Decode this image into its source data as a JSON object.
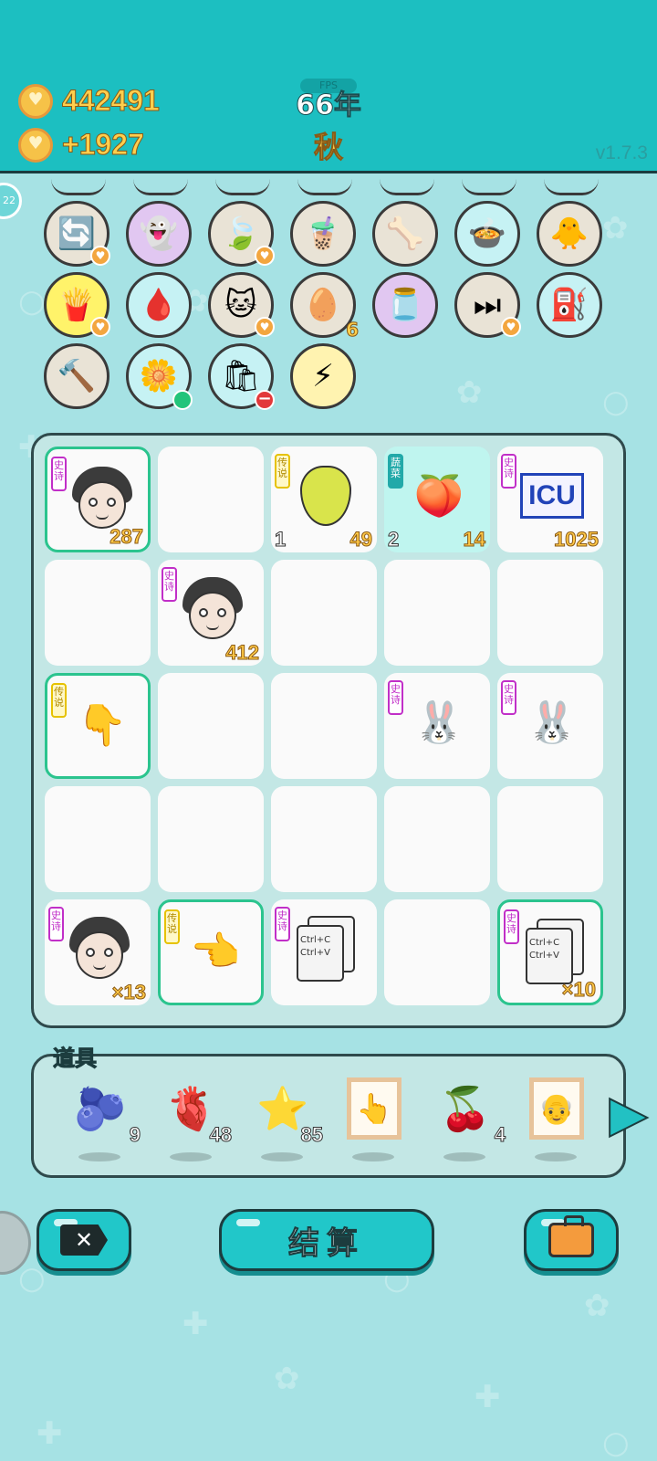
{
  "header": {
    "coins": "442491",
    "income": "+1927",
    "year_badge": "FPS",
    "year": "66年",
    "season": "秋",
    "version": "v1.7.3"
  },
  "side_badge": "22",
  "items_row1": [
    {
      "name": "refresh",
      "icon": "🔄",
      "mark": "♥"
    },
    {
      "name": "ghost",
      "icon": "👻",
      "mark": ""
    },
    {
      "name": "leaf",
      "icon": "🍃",
      "mark": "♥"
    },
    {
      "name": "bubble-tea",
      "icon": "🧋",
      "mark": ""
    },
    {
      "name": "dog-bowl",
      "icon": "🦴",
      "mark": ""
    },
    {
      "name": "pot-duck",
      "icon": "🍲",
      "mark": ""
    },
    {
      "name": "chick-egg",
      "icon": "🐥",
      "mark": ""
    }
  ],
  "items_row2": [
    {
      "name": "fries",
      "icon": "🍟",
      "mark": "♥"
    },
    {
      "name": "blood-bag",
      "icon": "🩸",
      "mark": ""
    },
    {
      "name": "cat",
      "icon": "🐱",
      "mark": "♥"
    },
    {
      "name": "egg-tray",
      "icon": "🥚",
      "count": "6"
    },
    {
      "name": "cream-jar",
      "icon": "🫙",
      "mark": ""
    },
    {
      "name": "skip",
      "icon": "⏭",
      "mark": "♥"
    },
    {
      "name": "pump",
      "icon": "⛽",
      "mark": ""
    }
  ],
  "items_row3": [
    {
      "name": "hammer",
      "icon": "🔨"
    },
    {
      "name": "flower-pot",
      "icon": "🌼"
    },
    {
      "name": "seed-bag",
      "icon": "🛍"
    },
    {
      "name": "lightning",
      "icon": "⚡"
    }
  ],
  "board": {
    "tags": {
      "epic": "史诗",
      "legend": "传说",
      "veg": "蔬菜"
    },
    "r1c1_num": "287",
    "r1c3_left": "1",
    "r1c3_num": "49",
    "r1c4_left": "2",
    "r1c4_num": "14",
    "r1c5_num": "1025",
    "icu": "ICU",
    "r2c2_num": "412",
    "r5c1_num": "×13",
    "r5c5_num": "×10",
    "copy_text": "Ctrl+C Ctrl+V"
  },
  "props": {
    "title": "道具",
    "items": [
      {
        "name": "blueberry",
        "icon": "🫐",
        "count": "9"
      },
      {
        "name": "liver",
        "icon": "🫀",
        "count": "48"
      },
      {
        "name": "star",
        "icon": "⭐",
        "count": "85"
      },
      {
        "name": "hand-frame",
        "icon": "👆",
        "count": ""
      },
      {
        "name": "lychee",
        "icon": "🍒",
        "count": "4"
      },
      {
        "name": "portrait-frame",
        "icon": "👴",
        "count": ""
      }
    ]
  },
  "buttons": {
    "exit": "✕",
    "settle": "结算"
  }
}
